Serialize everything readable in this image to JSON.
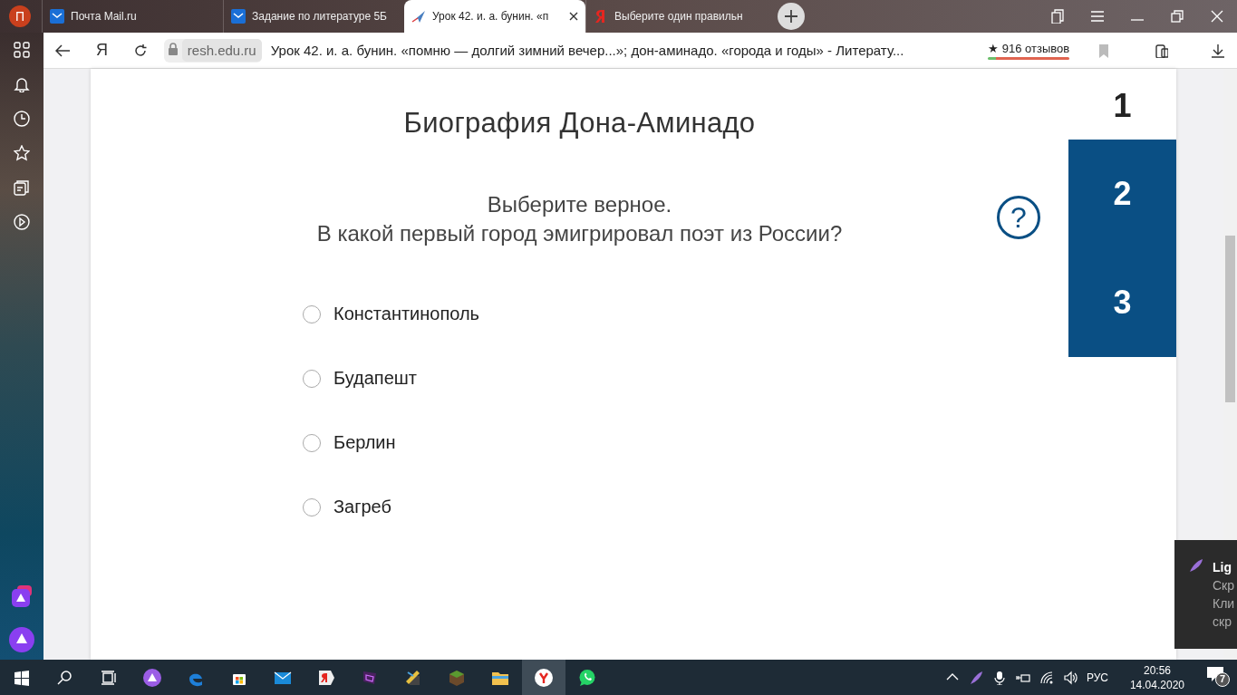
{
  "browser": {
    "profile_initial": "П",
    "tabs": [
      {
        "title": "Почта Mail.ru",
        "kind": "mail",
        "selected": false
      },
      {
        "title": "Задание по литературе 5Б",
        "kind": "mail",
        "selected": false
      },
      {
        "title": "Урок 42. и. а. бунин. «п",
        "kind": "resh",
        "selected": true
      },
      {
        "title": "Выберите один правильн",
        "kind": "yandex",
        "selected": false
      }
    ],
    "yandex_button": "Я",
    "address": {
      "domain": "resh.edu.ru",
      "page_title": "Урок 42. и. а. бунин. «помню — долгий зимний вечер...»; дон-аминадо. «города и годы» - Литерату..."
    },
    "reviews": {
      "star": "★",
      "text": "916 отзывов"
    }
  },
  "page": {
    "title": "Биография Дона-Аминадо",
    "prompt": [
      "Выберите верное.",
      "В какой первый город эмигрировал поэт из России?"
    ],
    "help_button": "?",
    "options": [
      {
        "label": "Константинополь",
        "selected": false
      },
      {
        "label": "Будапешт",
        "selected": false
      },
      {
        "label": "Берлин",
        "selected": false
      },
      {
        "label": "Загреб",
        "selected": false
      }
    ],
    "question_nav": [
      {
        "label": "1",
        "selected": true
      },
      {
        "label": "2",
        "selected": false
      },
      {
        "label": "3",
        "selected": false
      }
    ]
  },
  "notification": {
    "title": "Lig",
    "lines": [
      "Скр",
      "Кли",
      "скр"
    ]
  },
  "taskbar": {
    "language": "РУС",
    "time": "20:56",
    "date": "14.04.2020",
    "notification_count": "7"
  }
}
